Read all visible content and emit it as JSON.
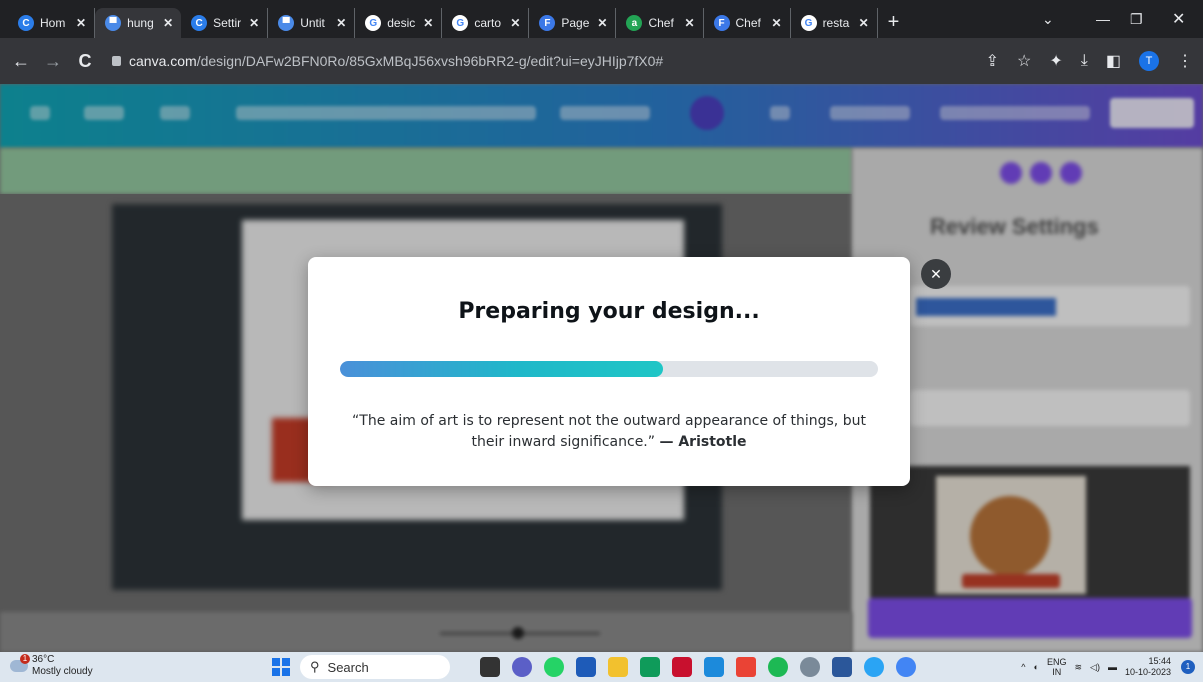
{
  "browser": {
    "tabs": [
      {
        "label": "Hom",
        "icon": "canva-icon",
        "color": "#2b7de9",
        "glyph": "C",
        "active": false
      },
      {
        "label": "hung",
        "icon": "calendar-icon",
        "color": "#4a8ae8",
        "glyph": "▀",
        "active": true
      },
      {
        "label": "Settir",
        "icon": "canva-icon",
        "color": "#2b7de9",
        "glyph": "C",
        "active": false
      },
      {
        "label": "Untit",
        "icon": "calendar-icon",
        "color": "#4a8ae8",
        "glyph": "▀",
        "active": false
      },
      {
        "label": "desic",
        "icon": "google-icon",
        "color": "#ffffff",
        "glyph": "G",
        "active": false
      },
      {
        "label": "carto",
        "icon": "google-icon",
        "color": "#ffffff",
        "glyph": "G",
        "active": false
      },
      {
        "label": "Page",
        "icon": "forms-icon",
        "color": "#3b78e7",
        "glyph": "F",
        "active": false
      },
      {
        "label": "Chef",
        "icon": "app-icon",
        "color": "#23a455",
        "glyph": "a",
        "active": false
      },
      {
        "label": "Chef",
        "icon": "forms-icon",
        "color": "#3b78e7",
        "glyph": "F",
        "active": false
      },
      {
        "label": "resta",
        "icon": "google-icon",
        "color": "#ffffff",
        "glyph": "G",
        "active": false
      }
    ],
    "new_tab": "+",
    "url_host": "canva.com",
    "url_path": "/design/DAFw2BFN0Ro/85GxMBqJ56xvsh96bRR2-g/edit?ui=eyJHIjp7fX0#",
    "profile_initial": "T"
  },
  "canva_panel": {
    "title": "Review Settings"
  },
  "modal": {
    "title": "Preparing your design...",
    "progress": 0.6,
    "quote": "“The aim of art is to represent not the outward appearance of things, but their inward significance.”",
    "author": "— Aristotle",
    "close_glyph": "✕"
  },
  "taskbar": {
    "weather_temp": "36°C",
    "weather_desc": "Mostly cloudy",
    "weather_badge": "1",
    "search_placeholder": "Search",
    "lang_top": "ENG",
    "lang_bottom": "IN",
    "time": "15:44",
    "date": "10-10-2023",
    "notification_count": "1"
  }
}
